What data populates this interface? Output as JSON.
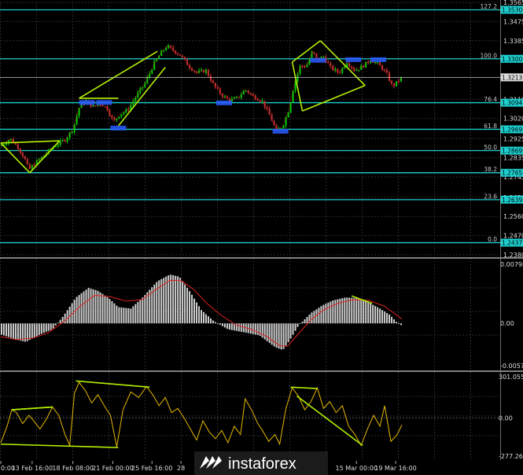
{
  "colors": {
    "background": "#000000",
    "grid": "#2a2a2a",
    "bull_candle": "#00d000",
    "bear_candle": "#c03030",
    "fib_level": "#1dd0d0",
    "channel": "#b4f000",
    "signal": "#e02020",
    "histogram": "#cfcfcf",
    "oscillator": "#e6b800",
    "separator": "#ffffff"
  },
  "watermark": {
    "text": "instaforex",
    "icon": "instaforex-logo-icon"
  },
  "chart_data": [
    {
      "type": "candlestick",
      "name": "price-panel",
      "ylim": [
        1.238,
        1.3565
      ],
      "y_ticks": [
        "1.3565",
        "1.3475",
        "1.3385",
        "1.3300",
        "1.3213",
        "1.3110",
        "1.3020",
        "1.2925",
        "1.2835",
        "1.2745",
        "1.2650",
        "1.2560",
        "1.2470",
        "1.2380"
      ],
      "y_tick_values": [
        1.3565,
        1.3475,
        1.3385,
        1.33,
        1.3213,
        1.311,
        1.302,
        1.2925,
        1.2835,
        1.2745,
        1.265,
        1.256,
        1.247,
        1.238
      ],
      "current_price": "1.3213",
      "fib_levels": [
        {
          "pct": "127.2",
          "price": "1.3530"
        },
        {
          "pct": "100.0",
          "price": "1.3300"
        },
        {
          "pct": "76.4",
          "price": "1.3094"
        },
        {
          "pct": "61.8",
          "price": "1.2969"
        },
        {
          "pct": "50.0",
          "price": "1.2869"
        },
        {
          "pct": "38.2",
          "price": "1.2765"
        },
        {
          "pct": "23.6",
          "price": "1.2639"
        },
        {
          "pct": "0.0",
          "price": "1.2437"
        }
      ],
      "price_path": [
        [
          0,
          1.289
        ],
        [
          12,
          1.2925
        ],
        [
          22,
          1.2885
        ],
        [
          30,
          1.2835
        ],
        [
          36,
          1.278
        ],
        [
          44,
          1.281
        ],
        [
          56,
          1.285
        ],
        [
          68,
          1.289
        ],
        [
          82,
          1.292
        ],
        [
          92,
          1.297
        ],
        [
          100,
          1.307
        ],
        [
          108,
          1.31
        ],
        [
          118,
          1.3075
        ],
        [
          128,
          1.309
        ],
        [
          136,
          1.3065
        ],
        [
          144,
          1.3005
        ],
        [
          152,
          1.304
        ],
        [
          162,
          1.306
        ],
        [
          172,
          1.312
        ],
        [
          184,
          1.3185
        ],
        [
          196,
          1.328
        ],
        [
          204,
          1.3325
        ],
        [
          212,
          1.336
        ],
        [
          220,
          1.334
        ],
        [
          230,
          1.3315
        ],
        [
          240,
          1.3265
        ],
        [
          250,
          1.3235
        ],
        [
          262,
          1.3245
        ],
        [
          272,
          1.3175
        ],
        [
          282,
          1.313
        ],
        [
          292,
          1.3105
        ],
        [
          302,
          1.3115
        ],
        [
          312,
          1.3155
        ],
        [
          322,
          1.3125
        ],
        [
          334,
          1.31
        ],
        [
          344,
          1.303
        ],
        [
          352,
          1.296
        ],
        [
          360,
          1.2985
        ],
        [
          368,
          1.3065
        ],
        [
          374,
          1.3175
        ],
        [
          382,
          1.3265
        ],
        [
          390,
          1.3265
        ],
        [
          398,
          1.3335
        ],
        [
          404,
          1.3295
        ],
        [
          412,
          1.331
        ],
        [
          422,
          1.3255
        ],
        [
          432,
          1.3235
        ],
        [
          442,
          1.3285
        ],
        [
          452,
          1.3245
        ],
        [
          462,
          1.3265
        ],
        [
          472,
          1.3295
        ],
        [
          482,
          1.3275
        ],
        [
          492,
          1.3235
        ],
        [
          500,
          1.317
        ],
        [
          506,
          1.319
        ],
        [
          512,
          1.3213
        ]
      ],
      "channel_lines": [
        {
          "from": [
            0,
            1.2905
          ],
          "to": [
            75,
            1.2915
          ]
        },
        {
          "from": [
            37,
            1.2765
          ],
          "to": [
            75,
            1.2915
          ]
        },
        {
          "from": [
            0,
            1.2905
          ],
          "to": [
            37,
            1.2765
          ]
        },
        {
          "from": [
            100,
            1.3115
          ],
          "to": [
            200,
            1.3335
          ]
        },
        {
          "from": [
            100,
            1.3115
          ],
          "to": [
            150,
            1.3115
          ]
        },
        {
          "from": [
            150,
            1.2985
          ],
          "to": [
            210,
            1.326
          ]
        },
        {
          "from": [
            372,
            1.3285
          ],
          "to": [
            408,
            1.3385
          ]
        },
        {
          "from": [
            408,
            1.3385
          ],
          "to": [
            465,
            1.3175
          ]
        },
        {
          "from": [
            385,
            1.3055
          ],
          "to": [
            465,
            1.3175
          ]
        },
        {
          "from": [
            372,
            1.3285
          ],
          "to": [
            385,
            1.3055
          ]
        }
      ],
      "fractal_marks": [
        {
          "x": 110,
          "y": 1.3095
        },
        {
          "x": 132,
          "y": 1.3095
        },
        {
          "x": 150,
          "y": 1.2975
        },
        {
          "x": 285,
          "y": 1.3093
        },
        {
          "x": 357,
          "y": 1.296
        },
        {
          "x": 405,
          "y": 1.3293
        },
        {
          "x": 450,
          "y": 1.3296
        },
        {
          "x": 482,
          "y": 1.3296
        }
      ]
    },
    {
      "type": "histogram",
      "name": "macd-panel",
      "ylim": [
        -0.00571,
        0.00798
      ],
      "y_ticks": [
        "0.00798",
        "0.00",
        "-0.00571"
      ],
      "y_tick_values": [
        0.00798,
        0.0,
        -0.00571
      ],
      "hist_path": [
        [
          0,
          -0.0015
        ],
        [
          20,
          -0.0022
        ],
        [
          32,
          -0.0025
        ],
        [
          50,
          -0.0015
        ],
        [
          66,
          -0.0008
        ],
        [
          80,
          0.001
        ],
        [
          96,
          0.0035
        ],
        [
          112,
          0.0048
        ],
        [
          124,
          0.0044
        ],
        [
          138,
          0.0034
        ],
        [
          150,
          0.0022
        ],
        [
          166,
          0.002
        ],
        [
          182,
          0.0036
        ],
        [
          200,
          0.0057
        ],
        [
          216,
          0.0066
        ],
        [
          228,
          0.0063
        ],
        [
          242,
          0.0042
        ],
        [
          256,
          0.0018
        ],
        [
          272,
          0.0003
        ],
        [
          290,
          -0.0008
        ],
        [
          310,
          -0.0012
        ],
        [
          330,
          -0.0016
        ],
        [
          350,
          -0.0032
        ],
        [
          360,
          -0.0036
        ],
        [
          368,
          -0.0024
        ],
        [
          380,
          -0.0003
        ],
        [
          396,
          0.0014
        ],
        [
          410,
          0.0024
        ],
        [
          424,
          0.0031
        ],
        [
          440,
          0.0035
        ],
        [
          456,
          0.0034
        ],
        [
          470,
          0.0028
        ],
        [
          484,
          0.002
        ],
        [
          496,
          0.0012
        ],
        [
          506,
          0.0001
        ],
        [
          512,
          -0.0003
        ]
      ],
      "signal_path": [
        [
          0,
          -0.0018
        ],
        [
          20,
          -0.0022
        ],
        [
          40,
          -0.002
        ],
        [
          60,
          -0.0013
        ],
        [
          80,
          0.0002
        ],
        [
          100,
          0.0022
        ],
        [
          120,
          0.0038
        ],
        [
          140,
          0.0036
        ],
        [
          160,
          0.003
        ],
        [
          180,
          0.0032
        ],
        [
          200,
          0.0047
        ],
        [
          216,
          0.0058
        ],
        [
          230,
          0.0058
        ],
        [
          246,
          0.0046
        ],
        [
          262,
          0.0028
        ],
        [
          280,
          0.0012
        ],
        [
          300,
          -0.0002
        ],
        [
          320,
          -0.0008
        ],
        [
          340,
          -0.0018
        ],
        [
          356,
          -0.003
        ],
        [
          366,
          -0.0031
        ],
        [
          380,
          -0.0014
        ],
        [
          396,
          0.0005
        ],
        [
          412,
          0.0018
        ],
        [
          430,
          0.0027
        ],
        [
          450,
          0.0032
        ],
        [
          470,
          0.0031
        ],
        [
          490,
          0.0023
        ],
        [
          512,
          0.0006
        ]
      ],
      "divergence_lines": [
        {
          "from": [
            448,
            0.0037
          ],
          "to": [
            474,
            0.0027
          ]
        }
      ]
    },
    {
      "type": "line",
      "name": "oscillator-panel",
      "ylim": [
        -277.2612,
        301.0559
      ],
      "y_ticks": [
        "301.0559",
        "0.00",
        "-277.26126"
      ],
      "y_tick_values": [
        301.0559,
        0.0,
        -277.2612
      ],
      "series": [
        {
          "values": [
            [
              0,
              -180
            ],
            [
              8,
              -60
            ],
            [
              14,
              60
            ],
            [
              20,
              40
            ],
            [
              28,
              -40
            ],
            [
              36,
              20
            ],
            [
              42,
              -20
            ],
            [
              50,
              -80
            ],
            [
              58,
              -10
            ],
            [
              66,
              80
            ],
            [
              74,
              20
            ],
            [
              82,
              -120
            ],
            [
              88,
              -200
            ],
            [
              94,
              180
            ],
            [
              100,
              260
            ],
            [
              108,
              200
            ],
            [
              116,
              110
            ],
            [
              124,
              170
            ],
            [
              132,
              90
            ],
            [
              140,
              20
            ],
            [
              148,
              -210
            ],
            [
              156,
              60
            ],
            [
              166,
              190
            ],
            [
              176,
              150
            ],
            [
              186,
              230
            ],
            [
              194,
              170
            ],
            [
              202,
              90
            ],
            [
              210,
              150
            ],
            [
              218,
              40
            ],
            [
              226,
              70
            ],
            [
              234,
              0
            ],
            [
              242,
              -80
            ],
            [
              250,
              -160
            ],
            [
              258,
              -20
            ],
            [
              266,
              -100
            ],
            [
              274,
              -150
            ],
            [
              282,
              -90
            ],
            [
              290,
              -180
            ],
            [
              298,
              -60
            ],
            [
              306,
              -120
            ],
            [
              312,
              140
            ],
            [
              320,
              60
            ],
            [
              328,
              -40
            ],
            [
              334,
              -90
            ],
            [
              342,
              -170
            ],
            [
              350,
              -120
            ],
            [
              356,
              -190
            ],
            [
              364,
              70
            ],
            [
              372,
              220
            ],
            [
              380,
              160
            ],
            [
              388,
              60
            ],
            [
              396,
              120
            ],
            [
              404,
              220
            ],
            [
              412,
              70
            ],
            [
              420,
              120
            ],
            [
              428,
              40
            ],
            [
              436,
              90
            ],
            [
              444,
              -60
            ],
            [
              452,
              -120
            ],
            [
              460,
              -200
            ],
            [
              468,
              -80
            ],
            [
              476,
              20
            ],
            [
              484,
              -60
            ],
            [
              490,
              90
            ],
            [
              498,
              -170
            ],
            [
              506,
              -120
            ],
            [
              512,
              -50
            ]
          ]
        }
      ],
      "divergence_lines": [
        {
          "from": [
            14,
            60
          ],
          "to": [
            66,
            80
          ]
        },
        {
          "from": [
            14,
            60
          ],
          "to": [
            66,
            80
          ]
        },
        {
          "from": [
            0,
            -190
          ],
          "to": [
            150,
            -215
          ]
        },
        {
          "from": [
            96,
            270
          ],
          "to": [
            190,
            225
          ]
        },
        {
          "from": [
            370,
            225
          ],
          "to": [
            404,
            215
          ]
        },
        {
          "from": [
            378,
            160
          ],
          "to": [
            462,
            -200
          ]
        }
      ]
    }
  ],
  "x_axis": {
    "labels": [
      "0:00",
      "13 Feb 16:00",
      "18 Feb 08:00",
      "21 Feb 00:00",
      "25 Feb 16:00",
      "28",
      "15 Mar 00:00",
      "19 Mar 16:00"
    ],
    "label_positions": [
      0,
      40,
      92,
      143,
      193,
      230,
      454,
      504
    ]
  }
}
